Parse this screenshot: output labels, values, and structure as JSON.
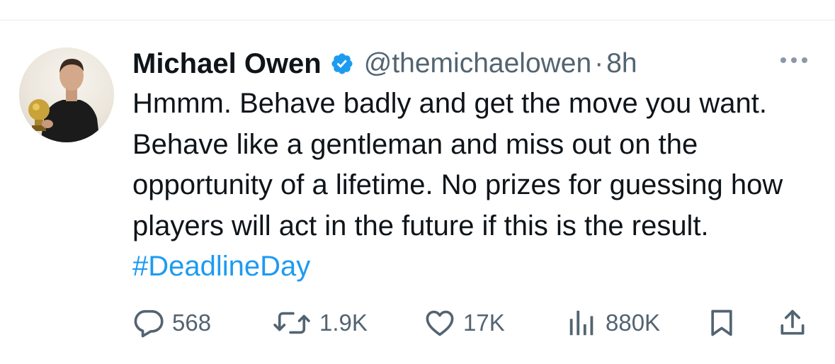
{
  "tweet": {
    "author_name": "Michael Owen",
    "handle": "@themichaelowen",
    "separator": "·",
    "time": "8h",
    "text": "Hmmm. Behave badly and get the move you want. Behave like a gentleman and miss out on the opportunity of a lifetime. No prizes for guessing how players will act in the future if this is the result. ",
    "hashtag": "#DeadlineDay",
    "verified": true
  },
  "actions": {
    "replies": "568",
    "reposts": "1.9K",
    "likes": "17K",
    "views": "880K"
  },
  "icons": {
    "reply": "reply-icon",
    "repost": "repost-icon",
    "like": "heart-icon",
    "views": "views-icon",
    "bookmark": "bookmark-icon",
    "share": "share-icon",
    "more": "more-icon",
    "verified": "verified-badge-icon"
  },
  "colors": {
    "text": "#0f1419",
    "secondary": "#536471",
    "accent": "#1d9bf0"
  }
}
